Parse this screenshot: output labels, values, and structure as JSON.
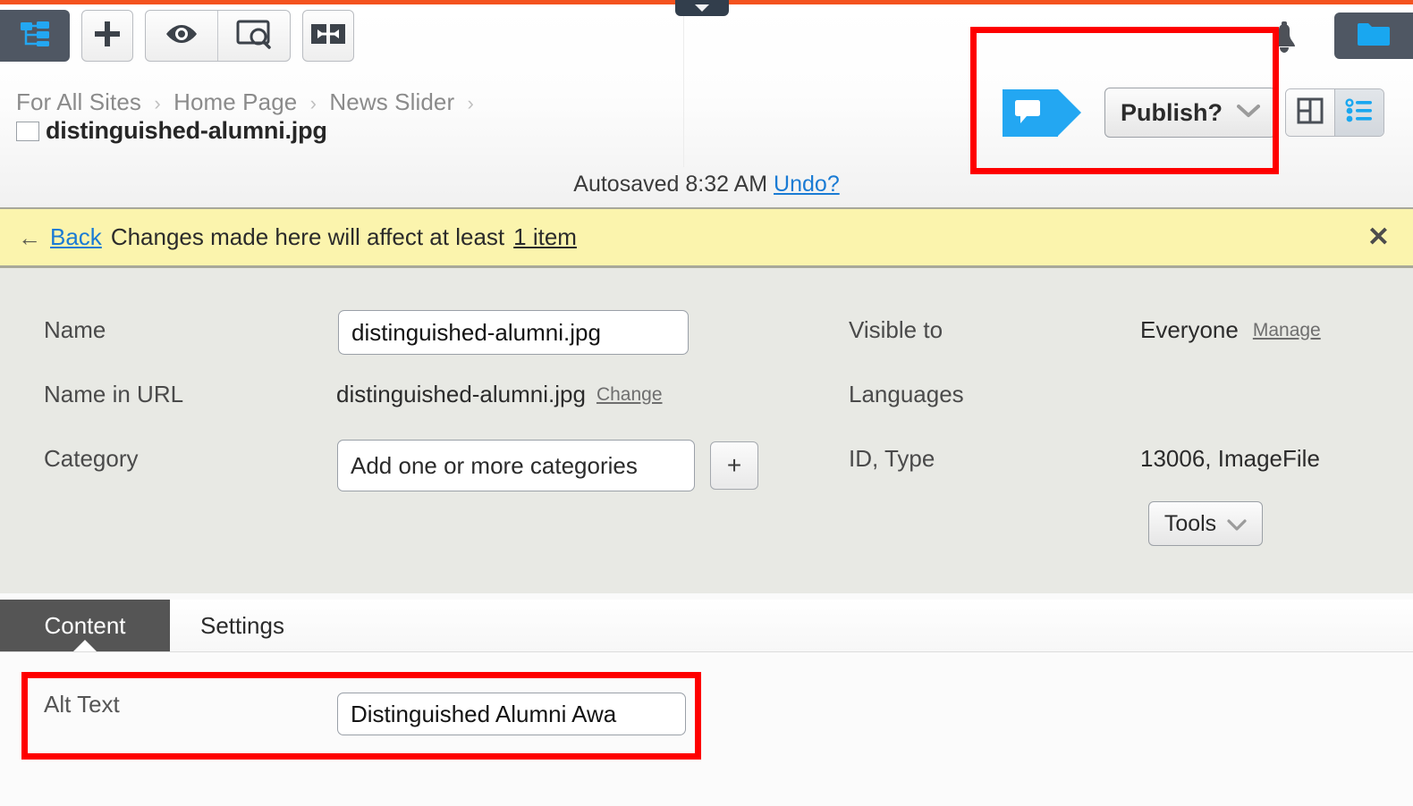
{
  "theme": {
    "accent_orange": "#f4531f",
    "accent_blue": "#23a7f2",
    "annotation_red": "#fe0000",
    "notice_yellow": "#fbf4ad",
    "panel_gray": "#e8e9e4",
    "toolbar_dark": "#4f5763",
    "tab_active_dark": "#555555",
    "link_blue": "#1a7bd4"
  },
  "toolbar": {
    "sitemap_button": "sitemap-icon",
    "add_button": "plus-icon",
    "preview_button": "eye-icon",
    "inspect_button": "screen-search-icon",
    "resize_button": "expand-horizontal-icon",
    "pull_tab": "chevron-down-icon",
    "notifications": "bell-icon",
    "files_button": "folder-icon"
  },
  "breadcrumb": {
    "items": [
      "For All Sites",
      "Home Page",
      "News Slider"
    ],
    "separator": "›",
    "trailing_separator": "›"
  },
  "page": {
    "title": "distinguished-alumni.jpg",
    "icon": "image-file-icon"
  },
  "autosave": {
    "text": "Autosaved 8:32 AM",
    "undo_label": "Undo?"
  },
  "actions": {
    "chat_icon": "comment-bubble-icon",
    "publish_label": "Publish?",
    "publish_caret": "chevron-down-icon",
    "view_grid": "grid-view-icon",
    "view_list": "list-view-icon"
  },
  "notice": {
    "back_arrow": "←",
    "back_label": "Back",
    "message_before": "Changes made here will affect at least",
    "affected_items": "1 item",
    "close_label": "✕"
  },
  "metadata": {
    "left": [
      {
        "label": "Name",
        "value": "distinguished-alumni.jpg",
        "type": "input"
      },
      {
        "label": "Name in URL",
        "value": "distinguished-alumni.jpg",
        "type": "text",
        "action": "Change"
      },
      {
        "label": "Category",
        "value": "Add one or more categories",
        "type": "input",
        "add_button": "+"
      }
    ],
    "right": [
      {
        "label": "Visible to",
        "value": "Everyone",
        "action": "Manage"
      },
      {
        "label": "Languages",
        "value": ""
      },
      {
        "label": "ID, Type",
        "value": "13006, ImageFile"
      }
    ],
    "tools_label": "Tools",
    "tools_caret": "chevron-down-icon"
  },
  "tabs": [
    {
      "label": "Content",
      "active": true
    },
    {
      "label": "Settings",
      "active": false
    }
  ],
  "content": {
    "alt_text_label": "Alt Text",
    "alt_text_value": "Distinguished Alumni Awa"
  }
}
